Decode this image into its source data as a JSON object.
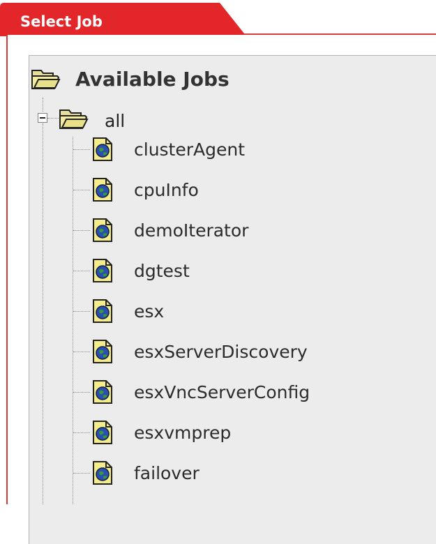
{
  "tab": {
    "title": "Select Job"
  },
  "tree": {
    "root_label": "Available Jobs",
    "group_label": "all",
    "jobs": [
      "clusterAgent",
      "cpuInfo",
      "demoIterator",
      "dgtest",
      "esx",
      "esxServerDiscovery",
      "esxVncServerConfig",
      "esxvmprep",
      "failover"
    ]
  },
  "colors": {
    "tab_red": "#e3262a",
    "border_red": "#d63a3a",
    "tree_background": "#ececec"
  }
}
